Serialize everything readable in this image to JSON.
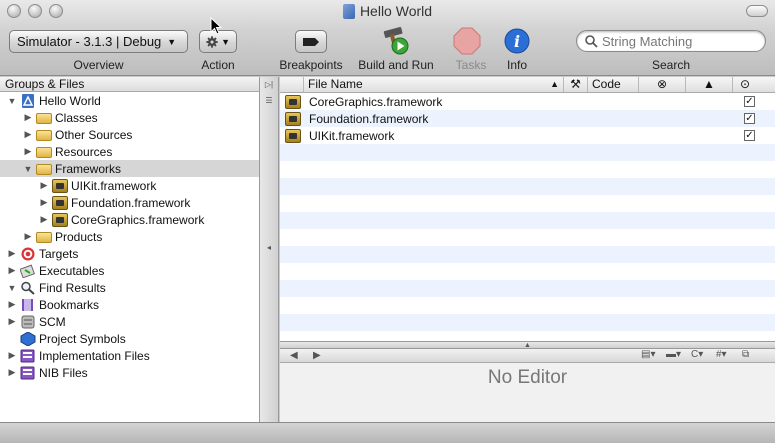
{
  "window": {
    "title": "Hello World"
  },
  "toolbar": {
    "overview_value": "Simulator - 3.1.3 | Debug",
    "overview_label": "Overview",
    "action_label": "Action",
    "breakpoints_label": "Breakpoints",
    "build_label": "Build and Run",
    "tasks_label": "Tasks",
    "info_label": "Info",
    "search_label": "Search",
    "search_placeholder": "String Matching"
  },
  "groups": {
    "header": "Groups & Files",
    "items": [
      {
        "label": "Hello World",
        "indent": 0,
        "disclosure": "open",
        "icon": "project-icon"
      },
      {
        "label": "Classes",
        "indent": 1,
        "disclosure": "closed",
        "icon": "folder-icon"
      },
      {
        "label": "Other Sources",
        "indent": 1,
        "disclosure": "closed",
        "icon": "folder-icon"
      },
      {
        "label": "Resources",
        "indent": 1,
        "disclosure": "closed",
        "icon": "folder-icon"
      },
      {
        "label": "Frameworks",
        "indent": 1,
        "disclosure": "open",
        "icon": "folder-icon",
        "selected": true
      },
      {
        "label": "UIKit.framework",
        "indent": 2,
        "disclosure": "closed",
        "icon": "framework-icon"
      },
      {
        "label": "Foundation.framework",
        "indent": 2,
        "disclosure": "closed",
        "icon": "framework-icon"
      },
      {
        "label": "CoreGraphics.framework",
        "indent": 2,
        "disclosure": "closed",
        "icon": "framework-icon"
      },
      {
        "label": "Products",
        "indent": 1,
        "disclosure": "closed",
        "icon": "folder-icon"
      },
      {
        "label": "Targets",
        "indent": 0,
        "disclosure": "closed",
        "icon": "target-icon"
      },
      {
        "label": "Executables",
        "indent": 0,
        "disclosure": "closed",
        "icon": "executable-icon"
      },
      {
        "label": "Find Results",
        "indent": 0,
        "disclosure": "open",
        "icon": "magnifier-icon"
      },
      {
        "label": "Bookmarks",
        "indent": 0,
        "disclosure": "closed",
        "icon": "bookmark-icon"
      },
      {
        "label": "SCM",
        "indent": 0,
        "disclosure": "closed",
        "icon": "scm-icon"
      },
      {
        "label": "Project Symbols",
        "indent": 0,
        "disclosure": "none",
        "icon": "symbols-icon"
      },
      {
        "label": "Implementation Files",
        "indent": 0,
        "disclosure": "closed",
        "icon": "smart-group-icon"
      },
      {
        "label": "NIB Files",
        "indent": 0,
        "disclosure": "closed",
        "icon": "smart-group-icon"
      }
    ]
  },
  "file_list": {
    "columns": {
      "file_name": "File Name",
      "code": "Code"
    },
    "rows": [
      {
        "name": "CoreGraphics.framework",
        "checked": true
      },
      {
        "name": "Foundation.framework",
        "checked": true
      },
      {
        "name": "UIKit.framework",
        "checked": true
      }
    ]
  },
  "editor": {
    "empty_label": "No Editor"
  }
}
